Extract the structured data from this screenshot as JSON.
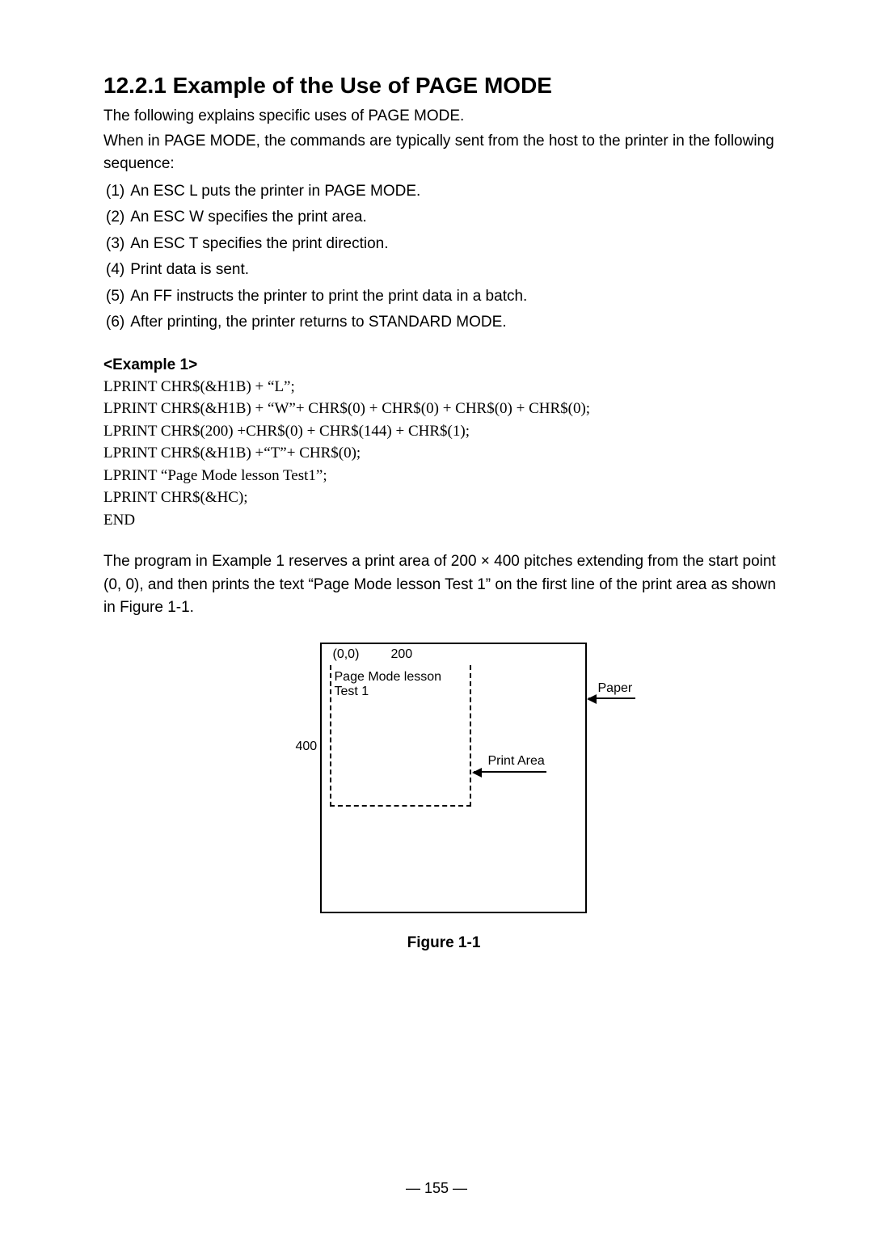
{
  "heading": "12.2.1 Example of the Use of PAGE MODE",
  "intro1": "The following explains specific uses of PAGE MODE.",
  "intro2": "When in PAGE MODE, the commands are typically sent from the host to the printer in the following sequence:",
  "steps": [
    {
      "n": "(1)",
      "t": "An ESC L puts the printer in PAGE MODE."
    },
    {
      "n": "(2)",
      "t": "An ESC W specifies the print area."
    },
    {
      "n": "(3)",
      "t": "An ESC T specifies the print direction."
    },
    {
      "n": "(4)",
      "t": "Print data is sent."
    },
    {
      "n": "(5)",
      "t": "An FF instructs the printer to print the print data in a batch."
    },
    {
      "n": "(6)",
      "t": "After printing, the printer returns to STANDARD MODE."
    }
  ],
  "example_title": "<Example 1>",
  "code_lines": [
    "LPRINT CHR$(&H1B) + “L”;",
    "LPRINT CHR$(&H1B) + “W”+ CHR$(0) + CHR$(0) + CHR$(0) + CHR$(0);",
    "LPRINT CHR$(200) +CHR$(0) + CHR$(144) + CHR$(1);",
    "LPRINT CHR$(&H1B) +“T”+ CHR$(0);",
    "LPRINT “Page Mode lesson Test1”;",
    "LPRINT CHR$(&HC);",
    "END"
  ],
  "paragraph": "The program in Example 1 reserves a print area of 200 × 400 pitches extending from the start point (0, 0), and then prints the text “Page Mode lesson Test 1” on the first line of the print area as shown in Figure 1-1.",
  "diagram": {
    "origin": "(0,0)",
    "width_label": "200",
    "height_label": "400",
    "printed_text_l1": "Page Mode lesson",
    "printed_text_l2": "Test 1",
    "paper_label": "Paper",
    "print_area_label": "Print Area"
  },
  "figure_caption": "Figure 1-1",
  "page_number": "— 155 —"
}
